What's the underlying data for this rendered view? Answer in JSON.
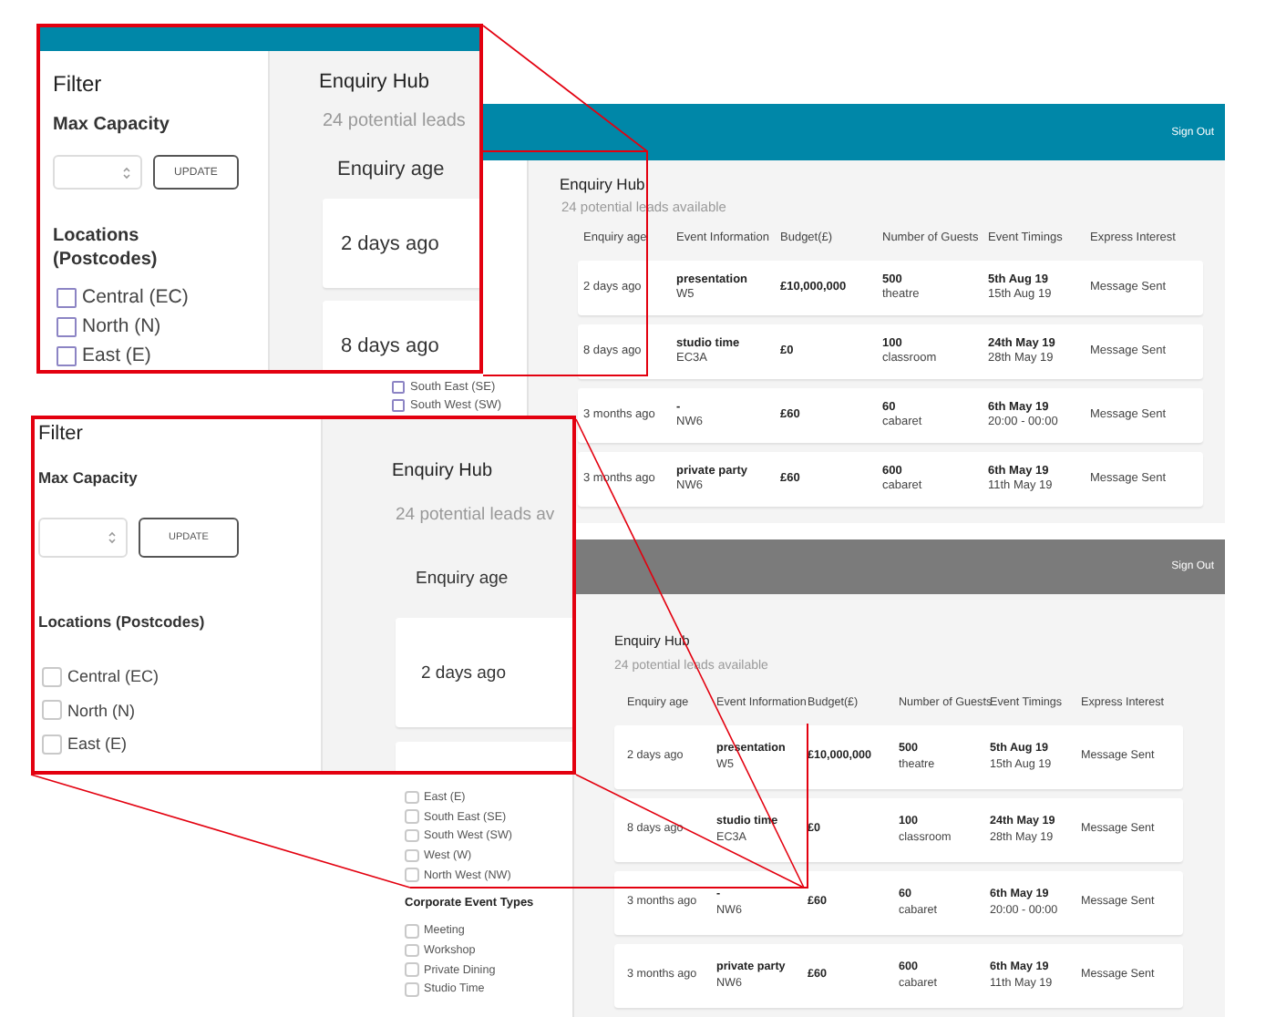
{
  "screenshots": [
    {
      "kind": "legacy",
      "color": "#0087a8",
      "sign_out": "Sign Out",
      "sidebar": {
        "groups": [
          {
            "items": [
              {
                "label": "South East (SE)",
                "checked": false
              },
              {
                "label": "South West (SW)",
                "checked": false
              }
            ]
          }
        ]
      },
      "hub": {
        "title": "Enquiry Hub",
        "subtitle": "24 potential leads available",
        "columns": [
          "Enquiry age",
          "Event Information",
          "Budget(£)",
          "Number of Guests",
          "Event Timings",
          "Express Interest"
        ],
        "rows": [
          {
            "age": "2 days ago",
            "event": "presentation",
            "postcode": "W5",
            "budget": "£10,000,000",
            "guests": "500",
            "layout": "theatre",
            "start": "5th Aug 19",
            "end": "15th Aug 19",
            "interest": "Message Sent"
          },
          {
            "age": "8 days ago",
            "event": "studio time",
            "postcode": "EC3A",
            "budget": "£0",
            "guests": "100",
            "layout": "classroom",
            "start": "24th May 19",
            "end": "28th May 19",
            "interest": "Message Sent"
          },
          {
            "age": "3 months ago",
            "event": "-",
            "postcode": "NW6",
            "budget": "£60",
            "guests": "60",
            "layout": "cabaret",
            "start": "6th May 19",
            "end": "20:00 - 00:00",
            "interest": "Message Sent"
          },
          {
            "age": "3 months ago",
            "event": "private party",
            "postcode": "NW6",
            "budget": "£60",
            "guests": "600",
            "layout": "cabaret",
            "start": "6th May 19",
            "end": "11th May 19",
            "interest": "Message Sent"
          }
        ]
      }
    },
    {
      "kind": "refreshed",
      "color": "#7b7b7b",
      "sign_out": "Sign Out",
      "sidebar": {
        "groups": [
          {
            "items": [
              {
                "label": "East (E)",
                "checked": false
              },
              {
                "label": "South East (SE)",
                "checked": false
              },
              {
                "label": "South West (SW)",
                "checked": false
              },
              {
                "label": "West (W)",
                "checked": false
              },
              {
                "label": "North West (NW)",
                "checked": false
              }
            ]
          },
          {
            "title": "Corporate Event Types",
            "items": [
              {
                "label": "Meeting",
                "checked": false
              },
              {
                "label": "Workshop",
                "checked": false
              },
              {
                "label": "Private Dining",
                "checked": false
              },
              {
                "label": "Studio Time",
                "checked": false
              }
            ]
          }
        ]
      },
      "hub": {
        "title": "Enquiry Hub",
        "subtitle": "24 potential leads available",
        "columns": [
          "Enquiry age",
          "Event Information",
          "Budget(£)",
          "Number of Guests",
          "Event Timings",
          "Express Interest"
        ],
        "rows": [
          {
            "age": "2 days ago",
            "event": "presentation",
            "postcode": "W5",
            "budget": "£10,000,000",
            "guests": "500",
            "layout": "theatre",
            "start": "5th Aug 19",
            "end": "15th Aug 19",
            "interest": "Message Sent"
          },
          {
            "age": "8 days ago",
            "event": "studio time",
            "postcode": "EC3A",
            "budget": "£0",
            "guests": "100",
            "layout": "classroom",
            "start": "24th May 19",
            "end": "28th May 19",
            "interest": "Message Sent"
          },
          {
            "age": "3 months ago",
            "event": "-",
            "postcode": "NW6",
            "budget": "£60",
            "guests": "60",
            "layout": "cabaret",
            "start": "6th May 19",
            "end": "20:00 - 00:00",
            "interest": "Message Sent"
          },
          {
            "age": "3 months ago",
            "event": "private party",
            "postcode": "NW6",
            "budget": "£60",
            "guests": "600",
            "layout": "cabaret",
            "start": "6th May 19",
            "end": "11th May 19",
            "interest": "Message Sent"
          }
        ]
      }
    }
  ],
  "callouts": [
    {
      "kind": "legacy",
      "color": "#0087a8",
      "filter": "Filter",
      "max_capacity": "Max Capacity",
      "update": "UPDATE",
      "locations_title": "Locations (Postcodes)",
      "locations": [
        {
          "label": "Central (EC)",
          "checked": false
        },
        {
          "label": "North (N)",
          "checked": false
        },
        {
          "label": "East (E)",
          "checked": false
        }
      ],
      "hub_title": "Enquiry Hub",
      "hub_subtitle": "24 potential leads",
      "age_column": "Enquiry age",
      "cards": [
        "2 days ago",
        "8 days ago"
      ]
    },
    {
      "kind": "refreshed",
      "filter": "Filter",
      "max_capacity": "Max Capacity",
      "update": "UPDATE",
      "locations_title": "Locations (Postcodes)",
      "locations": [
        {
          "label": "Central (EC)",
          "checked": false
        },
        {
          "label": "North (N)",
          "checked": false
        },
        {
          "label": "East (E)",
          "checked": false
        }
      ],
      "hub_title": "Enquiry Hub",
      "hub_subtitle": "24 potential leads av",
      "age_column": "Enquiry age",
      "cards": [
        "2 days ago"
      ]
    }
  ]
}
